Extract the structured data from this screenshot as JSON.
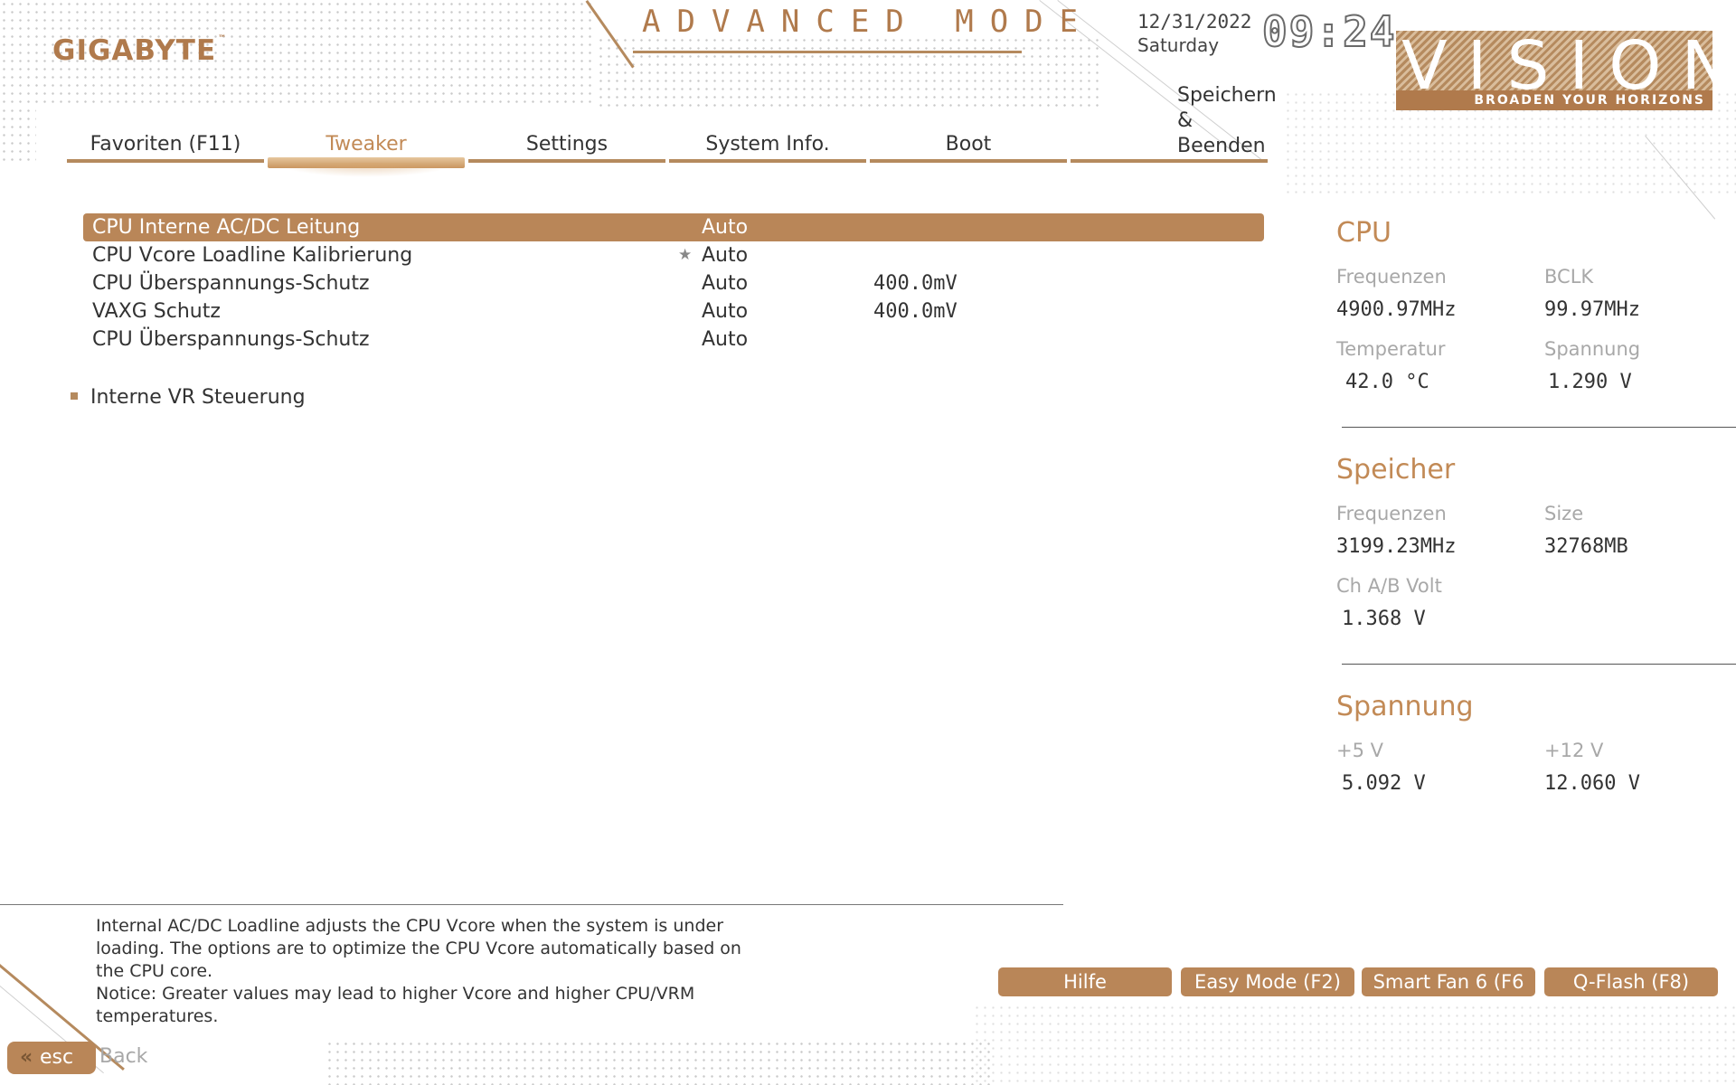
{
  "header": {
    "brand": "GIGABYTE",
    "trademark": "™",
    "mode_title": "ADVANCED MODE",
    "date": "12/31/2022",
    "weekday": "Saturday",
    "time": "09:24",
    "badge_word": "VISION",
    "badge_tagline": "BROADEN YOUR HORIZONS"
  },
  "tabs": [
    {
      "label": "Favoriten (F11)",
      "active": false
    },
    {
      "label": "Tweaker",
      "active": true
    },
    {
      "label": "Settings",
      "active": false
    },
    {
      "label": "System Info.",
      "active": false
    },
    {
      "label": "Boot",
      "active": false
    },
    {
      "label_line1": "Speichern",
      "label_line2": "& Beenden",
      "active": false
    }
  ],
  "settings": [
    {
      "name": "CPU Interne AC/DC Leitung",
      "value": "Auto",
      "extra": "",
      "selected": true
    },
    {
      "name": "CPU Vcore Loadline Kalibrierung",
      "value": "Auto",
      "extra": "",
      "starred": true
    },
    {
      "name": "CPU Überspannungs-Schutz",
      "value": "Auto",
      "extra": "400.0mV"
    },
    {
      "name": "VAXG Schutz",
      "value": "Auto",
      "extra": "400.0mV"
    },
    {
      "name": "CPU Überspannungs-Schutz",
      "value": "Auto",
      "extra": ""
    }
  ],
  "submenu": {
    "label": "Interne VR Steuerung"
  },
  "sidebar": {
    "cpu": {
      "title": "CPU",
      "freq_label": "Frequenzen",
      "freq_value": "4900.97MHz",
      "bclk_label": "BCLK",
      "bclk_value": "99.97MHz",
      "temp_label": "Temperatur",
      "temp_value": "42.0 °C",
      "volt_label": "Spannung",
      "volt_value": "1.290 V"
    },
    "memory": {
      "title": "Speicher",
      "freq_label": "Frequenzen",
      "freq_value": "3199.23MHz",
      "size_label": "Size",
      "size_value": "32768MB",
      "volt_label": "Ch A/B Volt",
      "volt_value": "1.368 V"
    },
    "voltage": {
      "title": "Spannung",
      "v5_label": "+5 V",
      "v5_value": "5.092 V",
      "v12_label": "+12 V",
      "v12_value": "12.060 V"
    }
  },
  "help": {
    "line1": "Internal AC/DC Loadline adjusts the CPU Vcore when the system is under",
    "line2": "loading. The options are to optimize the CPU Vcore automatically based on",
    "line3": "the CPU core.",
    "line4": "Notice: Greater values may lead to higher Vcore and higher CPU/VRM",
    "line5": "temperatures."
  },
  "buttons": {
    "help": "Hilfe",
    "easy_mode": "Easy Mode (F2)",
    "smart_fan": "Smart Fan 6 (F6",
    "qflash": "Q-Flash (F8)"
  },
  "footer": {
    "esc_label": "esc",
    "back_label": "Back"
  },
  "colors": {
    "accent": "#b98658",
    "accent_text": "#c28a56"
  }
}
